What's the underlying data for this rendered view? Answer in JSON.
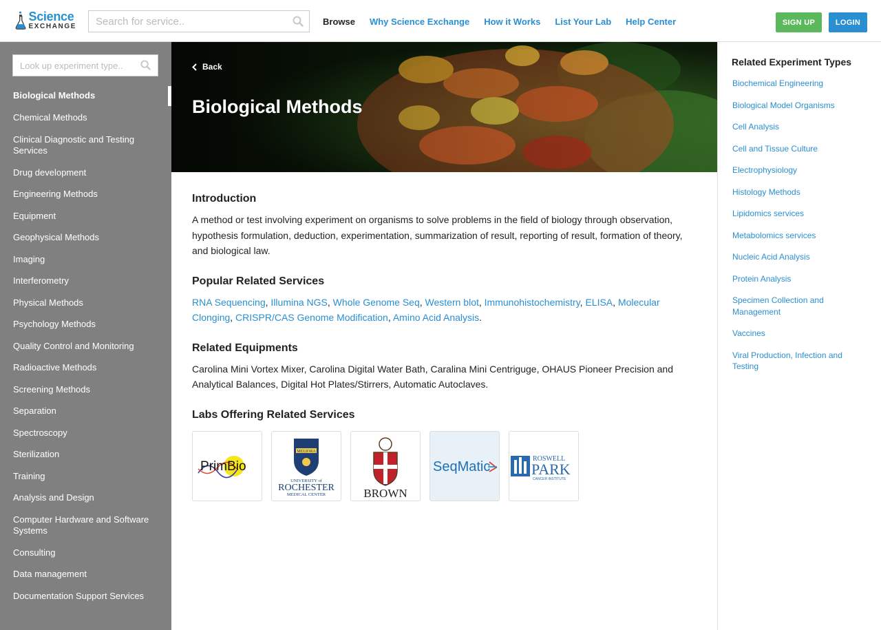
{
  "header": {
    "logo_line1": "Science",
    "logo_line2": "EXCHANGE",
    "search_placeholder": "Search for service..",
    "nav": [
      "Browse",
      "Why Science Exchange",
      "How it Works",
      "List Your Lab",
      "Help Center"
    ],
    "signup": "SIGN UP",
    "login": "LOGIN"
  },
  "sidebar": {
    "search_placeholder": "Look up experiment type..",
    "items": [
      "Biological Methods",
      "Chemical Methods",
      "Clinical Diagnostic and Testing Services",
      "Drug development",
      "Engineering Methods",
      "Equipment",
      "Geophysical Methods",
      "Imaging",
      "Interferometry",
      "Physical Methods",
      "Psychology Methods",
      "Quality Control and Monitoring",
      "Radioactive Methods",
      "Screening Methods",
      "Separation",
      "Spectroscopy",
      "Sterilization",
      "Training",
      "Analysis and Design",
      "Computer Hardware and Software Systems",
      "Consulting",
      "Data management",
      "Documentation Support Services"
    ]
  },
  "hero": {
    "back": "Back",
    "title": "Biological Methods"
  },
  "intro": {
    "heading": "Introduction",
    "text": "A method or test involving experiment on organisms to solve problems in the field of biology through observation, hypothesis formulation, deduction, experimentation, summarization of result, reporting of result, formation of theory, and biological law."
  },
  "popular": {
    "heading": "Popular Related Services",
    "links": [
      "RNA Sequencing",
      "Illumina NGS",
      "Whole Genome Seq",
      "Western blot",
      "Immunohistochemistry",
      "ELISA",
      "Molecular Clonging",
      "CRISPR/CAS Genome Modification",
      "Amino Acid Analysis"
    ]
  },
  "equipments": {
    "heading": "Related Equipments",
    "text": "Carolina Mini Vortex Mixer, Carolina Digital Water Bath, Caralina Mini Centriguge, OHAUS Pioneer Precision and Analytical Balances, Digital Hot Plates/Stirrers, Automatic Autoclaves."
  },
  "labs": {
    "heading": "Labs Offering Related Services",
    "primbio": "PrimBio",
    "rochester": {
      "motto": "MELIORA",
      "line1": "UNIVERSITY of",
      "line2": "ROCHESTER",
      "line3": "MEDICAL CENTER"
    },
    "brown": "BROWN",
    "seqmatic": "SeqMatic",
    "roswell": {
      "line1": "ROSWELL",
      "line2": "PARK",
      "line3": "CANCER INSTITUTE"
    }
  },
  "related": {
    "title": "Related Experiment Types",
    "items": [
      "Biochemical Engineering",
      "Biological Model Organisms",
      "Cell Analysis",
      "Cell and Tissue Culture",
      "Electrophysiology",
      "Histology Methods",
      "Lipidomics services",
      "Metabolomics services",
      "Nucleic Acid Analysis",
      "Protein Analysis",
      "Specimen Collection and Management",
      "Vaccines",
      "Viral Production, Infection and Testing"
    ]
  }
}
